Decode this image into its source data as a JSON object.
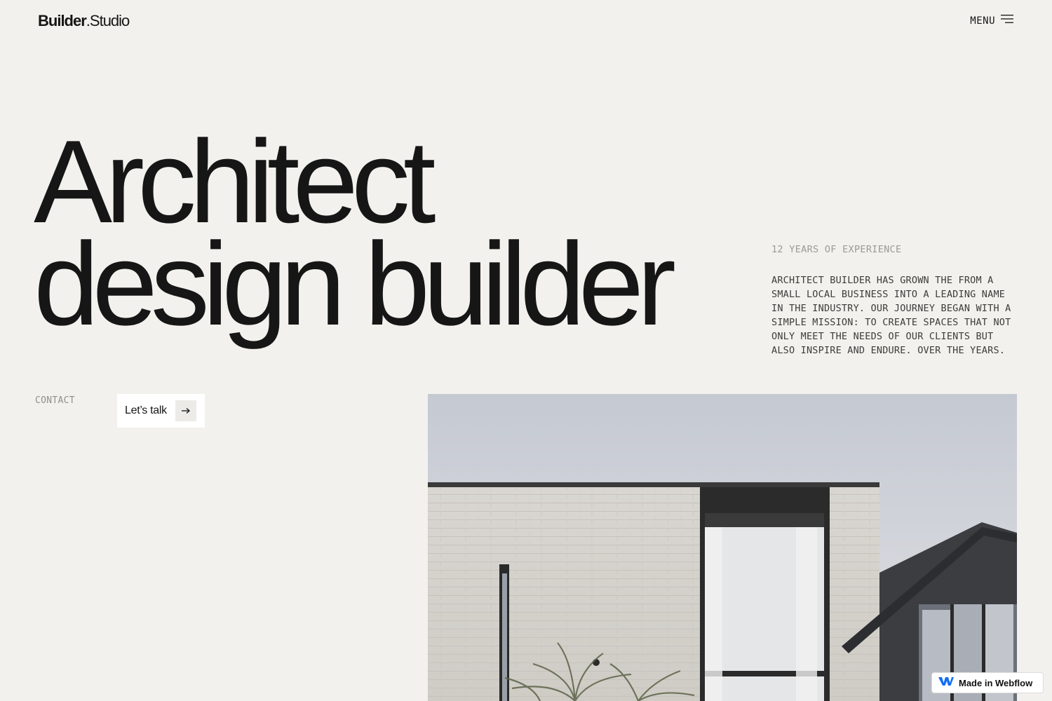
{
  "header": {
    "logo_bold": "Builder",
    "logo_light": ".Studio",
    "menu_label": "MENU",
    "menu_icon": "hamburger-icon"
  },
  "hero": {
    "line1": "Architect",
    "line2": "design builder"
  },
  "about": {
    "experience": "12 YEARS OF EXPERIENCE",
    "description": "ARCHITECT BUILDER HAS GROWN THE FROM A SMALL LOCAL BUSINESS INTO A LEADING NAME IN THE INDUSTRY. OUR JOURNEY BEGAN WITH A SIMPLE MISSION: TO CREATE SPACES THAT NOT ONLY MEET THE NEEDS OF OUR CLIENTS BUT ALSO INSPIRE AND ENDURE. OVER THE YEARS."
  },
  "contact": {
    "label": "CONTACT",
    "button_label": "Let’s talk",
    "button_icon": "arrow-right-icon"
  },
  "badge": {
    "label": "Made in Webflow",
    "icon": "webflow-logo-icon"
  },
  "colors": {
    "background": "#f2f1ed",
    "text": "#161616",
    "muted": "#9a9a96",
    "webflow_blue": "#146ef5"
  }
}
